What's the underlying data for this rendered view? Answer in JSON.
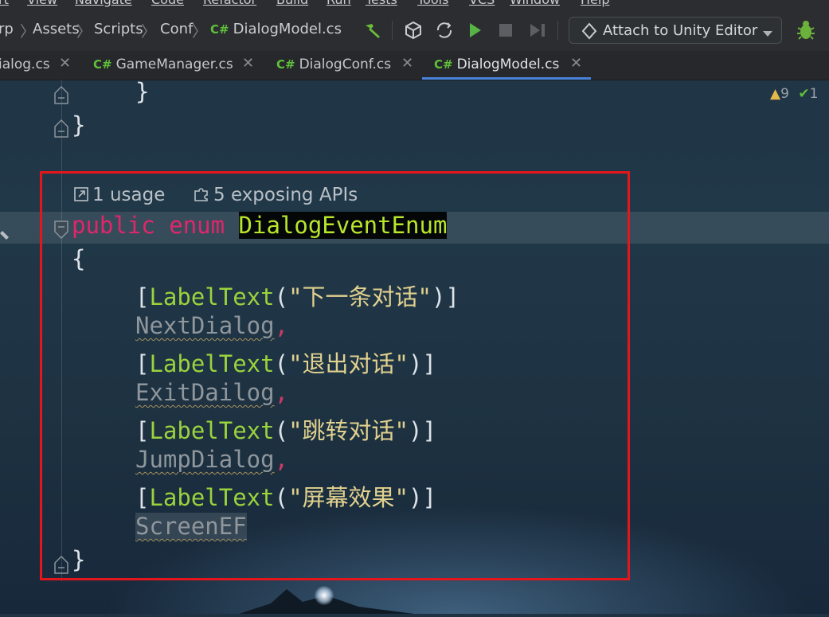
{
  "menu": [
    "rt",
    "View",
    "Navigate",
    "Code",
    "Refactor",
    "Build",
    "Run",
    "Tests",
    "Tools",
    "VCS",
    "Window",
    "Help"
  ],
  "breadcrumb": {
    "root": "rp",
    "items": [
      "Assets",
      "Scripts",
      "Conf"
    ],
    "file": "DialogModel.cs",
    "file_badge": "C#"
  },
  "toolbar": {
    "attach_label": "Attach to Unity Editor"
  },
  "tabs": [
    {
      "label": "ialog.cs",
      "badge": ""
    },
    {
      "label": "GameManager.cs",
      "badge": "C#"
    },
    {
      "label": "DialogConf.cs",
      "badge": "C#"
    },
    {
      "label": "DialogModel.cs",
      "badge": "C#"
    }
  ],
  "inspections": {
    "warnings": "9",
    "ok": "1"
  },
  "code": {
    "close_inner": "}",
    "close_outer": "}",
    "hint_usage": "1 usage",
    "hint_apis": "5 exposing APIs",
    "kw_public": "public",
    "kw_enum": "enum",
    "enum_name": "DialogEventEnum",
    "open_brace": "{",
    "attr_name": "LabelText",
    "members": [
      {
        "label": "\"下一条对话\"",
        "name": "NextDialog"
      },
      {
        "label": "\"退出对话\"",
        "name": "ExitDailog"
      },
      {
        "label": "\"跳转对话\"",
        "name": "JumpDialog"
      },
      {
        "label": "\"屏幕效果\"",
        "name": "ScreenEF"
      }
    ],
    "end_brace": "}"
  }
}
